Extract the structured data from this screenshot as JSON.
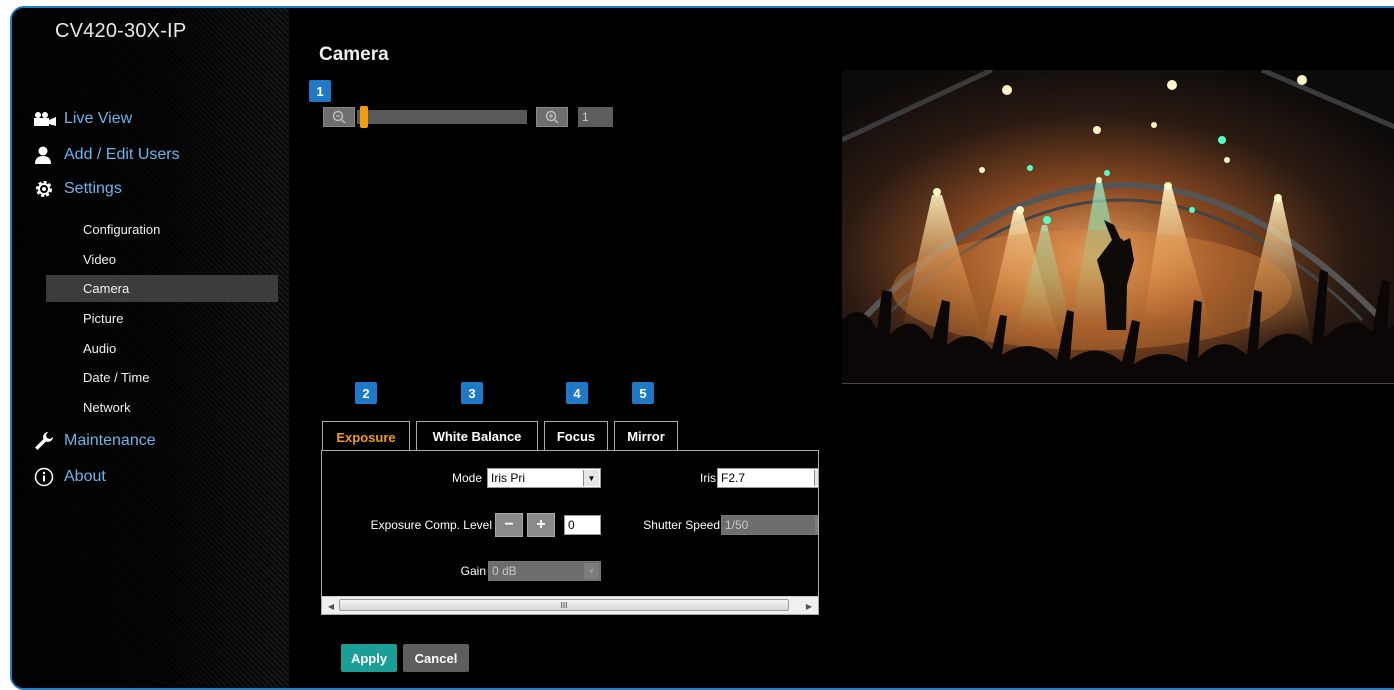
{
  "app": {
    "title": "CV420-30X-IP"
  },
  "nav": {
    "main": [
      {
        "label": "Live View",
        "icon": "video-camera-icon"
      },
      {
        "label": "Add / Edit Users",
        "icon": "user-icon"
      },
      {
        "label": "Settings",
        "icon": "gear-icon"
      },
      {
        "label": "Maintenance",
        "icon": "wrench-icon"
      },
      {
        "label": "About",
        "icon": "info-icon"
      }
    ],
    "settings_sub": [
      "Configuration",
      "Video",
      "Camera",
      "Picture",
      "Audio",
      "Date / Time",
      "Network"
    ],
    "active_sub": "Camera"
  },
  "page": {
    "title": "Camera"
  },
  "zoom": {
    "value": "1",
    "level": 0.0
  },
  "badges": [
    "1",
    "2",
    "3",
    "4",
    "5"
  ],
  "tabs": [
    "Exposure",
    "White Balance",
    "Focus",
    "Mirror"
  ],
  "active_tab": "Exposure",
  "exposure": {
    "mode_label": "Mode",
    "mode_value": "Iris Pri",
    "iris_label": "Iris",
    "iris_value": "F2.7",
    "comp_label": "Exposure Comp. Level",
    "comp_minus": "−",
    "comp_plus": "+",
    "comp_value": "0",
    "shutter_label": "Shutter Speed",
    "shutter_value": "1/50",
    "gain_label": "Gain",
    "gain_value": "0 dB"
  },
  "scrollbar": {
    "grip": "III"
  },
  "actions": {
    "apply": "Apply",
    "cancel": "Cancel"
  },
  "colors": {
    "accent": "#1f79c6",
    "active_tab": "#f39c12",
    "apply": "#1a9e96",
    "cancel": "#5e5e5e",
    "nav_link": "#6db4ec"
  }
}
